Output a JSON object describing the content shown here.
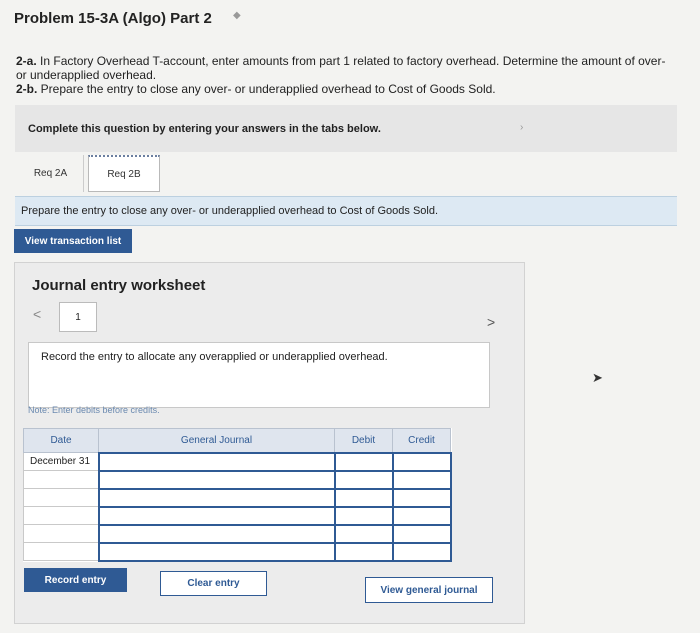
{
  "header": {
    "title": "Problem 15-3A (Algo) Part 2"
  },
  "question": {
    "line1_label": "2-a.",
    "line1_text": " In Factory Overhead T-account, enter amounts from part 1 related to factory overhead. Determine the amount of over- or underapplied overhead.",
    "line2_label": "2-b.",
    "line2_text": " Prepare the entry to close any over- or underapplied overhead to Cost of Goods Sold."
  },
  "banner": {
    "text": "Complete this question by entering your answers in the tabs below."
  },
  "tabs": [
    {
      "label": "Req 2A"
    },
    {
      "label": "Req 2B"
    }
  ],
  "prompt": {
    "text": "Prepare the entry to close any over- or underapplied overhead to Cost of Goods Sold."
  },
  "buttons": {
    "view_transaction_list": "View transaction list",
    "record_entry": "Record entry",
    "clear_entry": "Clear entry",
    "view_general_journal": "View general journal"
  },
  "worksheet": {
    "title": "Journal entry worksheet",
    "page": "1",
    "instruction": "Record the entry to allocate any overapplied or underapplied overhead.",
    "note": "Note: Enter debits before credits.",
    "columns": {
      "date": "Date",
      "general_journal": "General Journal",
      "debit": "Debit",
      "credit": "Credit"
    },
    "rows": [
      {
        "date": "December 31"
      },
      {
        "date": ""
      },
      {
        "date": ""
      },
      {
        "date": ""
      },
      {
        "date": ""
      },
      {
        "date": ""
      }
    ]
  },
  "colors": {
    "primary_blue": "#2f5a94",
    "prompt_bar": "#dde9f3",
    "banner_gray": "#e6e6e6"
  }
}
